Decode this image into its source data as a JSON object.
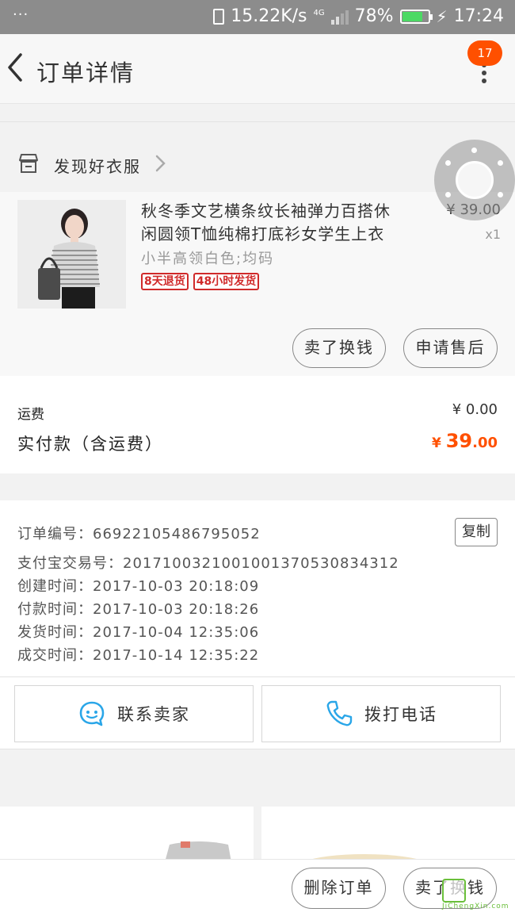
{
  "status_bar": {
    "dots": "···",
    "speed": "15.22K/s",
    "network": "4G",
    "battery": "78%",
    "time": "17:24"
  },
  "header": {
    "title": "订单详情",
    "badge": "17"
  },
  "shop": {
    "name": "发现好衣服"
  },
  "product": {
    "title_line1": "秋冬季文艺横条纹长袖弹力百搭休",
    "title_line2": "闲圆领T恤纯棉打底衫女学生上衣",
    "sku": "小半高领白色;均码",
    "tags": [
      "8天退货",
      "48小时发货"
    ],
    "price": "¥ 39.00",
    "qty": "x1",
    "btn_sell": "卖了换钱",
    "btn_after_sale": "申请售后"
  },
  "totals": {
    "shipping_label": "运费",
    "shipping_value": "¥ 0.00",
    "paid_label": "实付款（含运费）",
    "paid_currency": "¥ ",
    "paid_int": "39",
    "paid_dec": ".00"
  },
  "order_info": {
    "order_no": "订单编号：66922105486795052",
    "alipay_no": "支付宝交易号：2017100321001001370530834312",
    "created": "创建时间：2017-10-03 20:18:09",
    "paid": "付款时间：2017-10-03 20:18:26",
    "shipped": "发货时间：2017-10-04 12:35:06",
    "completed": "成交时间：2017-10-14 12:35:22",
    "copy_label": "复制"
  },
  "contact": {
    "seller": "联系卖家",
    "call": "拨打电话"
  },
  "bottom_bar": {
    "delete": "删除订单",
    "sell": "卖了换钱"
  },
  "watermark": {
    "text": "JiChengXin.com"
  },
  "colors": {
    "accent": "#ff5000",
    "tag_red": "#d02a2a",
    "icon_blue": "#2aa6e8"
  }
}
